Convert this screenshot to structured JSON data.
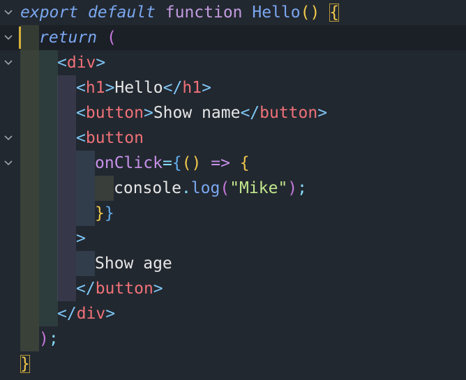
{
  "code_lines": [
    {
      "fold": "chevron-down",
      "tokens": [
        {
          "t": "export",
          "c": "kw"
        },
        {
          "t": " ",
          "c": "txt"
        },
        {
          "t": "default",
          "c": "kw"
        },
        {
          "t": " ",
          "c": "txt"
        },
        {
          "t": "function",
          "c": "fnkw"
        },
        {
          "t": " ",
          "c": "txt"
        },
        {
          "t": "Hello",
          "c": "fnname"
        },
        {
          "t": "()",
          "c": "paren-y"
        },
        {
          "t": " ",
          "c": "txt"
        },
        {
          "t": "{",
          "c": "paren-y bm"
        }
      ]
    },
    {
      "fold": "chevron-down",
      "current": true,
      "caret": true,
      "tokens": [
        {
          "t": "return",
          "c": "kw"
        },
        {
          "t": " ",
          "c": "txt"
        },
        {
          "t": "(",
          "c": "paren-p"
        }
      ]
    },
    {
      "fold": "chevron-down",
      "tokens": [
        {
          "t": "<",
          "c": "tagp"
        },
        {
          "t": "div",
          "c": "tag"
        },
        {
          "t": ">",
          "c": "tagp"
        }
      ]
    },
    {
      "tokens": [
        {
          "t": "<",
          "c": "tagp"
        },
        {
          "t": "h1",
          "c": "tag"
        },
        {
          "t": ">",
          "c": "tagp"
        },
        {
          "t": "Hello",
          "c": "txt"
        },
        {
          "t": "</",
          "c": "tagp"
        },
        {
          "t": "h1",
          "c": "tag"
        },
        {
          "t": ">",
          "c": "tagp"
        }
      ]
    },
    {
      "tokens": [
        {
          "t": "<",
          "c": "tagp"
        },
        {
          "t": "button",
          "c": "tag"
        },
        {
          "t": ">",
          "c": "tagp"
        },
        {
          "t": "Show name",
          "c": "txt"
        },
        {
          "t": "</",
          "c": "tagp"
        },
        {
          "t": "button",
          "c": "tag"
        },
        {
          "t": ">",
          "c": "tagp"
        }
      ]
    },
    {
      "fold": "chevron-down",
      "tokens": [
        {
          "t": "<",
          "c": "tagp"
        },
        {
          "t": "button",
          "c": "tag"
        }
      ]
    },
    {
      "fold": "chevron-down",
      "tokens": [
        {
          "t": "onClick",
          "c": "attr"
        },
        {
          "t": "=",
          "c": "op"
        },
        {
          "t": "{",
          "c": "paren-b"
        },
        {
          "t": "()",
          "c": "paren-y"
        },
        {
          "t": " ",
          "c": "txt"
        },
        {
          "t": "=>",
          "c": "attr"
        },
        {
          "t": " ",
          "c": "txt"
        },
        {
          "t": "{",
          "c": "paren-y"
        }
      ]
    },
    {
      "tokens": [
        {
          "t": "console",
          "c": "txt"
        },
        {
          "t": ".",
          "c": "op"
        },
        {
          "t": "log",
          "c": "method"
        },
        {
          "t": "(",
          "c": "paren-p"
        },
        {
          "t": "\"Mike\"",
          "c": "str"
        },
        {
          "t": ")",
          "c": "paren-p"
        },
        {
          "t": ";",
          "c": "op"
        }
      ]
    },
    {
      "tokens": [
        {
          "t": "}",
          "c": "paren-y"
        },
        {
          "t": "}",
          "c": "paren-b"
        }
      ]
    },
    {
      "tokens": [
        {
          "t": ">",
          "c": "tagp"
        }
      ]
    },
    {
      "tokens": [
        {
          "t": "Show age",
          "c": "txt"
        }
      ]
    },
    {
      "tokens": [
        {
          "t": "</",
          "c": "tagp"
        },
        {
          "t": "button",
          "c": "tag"
        },
        {
          "t": ">",
          "c": "tagp"
        }
      ]
    },
    {
      "tokens": [
        {
          "t": "</",
          "c": "tagp"
        },
        {
          "t": "div",
          "c": "tag"
        },
        {
          "t": ">",
          "c": "tagp"
        }
      ]
    },
    {
      "tokens": [
        {
          "t": ")",
          "c": "paren-p"
        },
        {
          "t": ";",
          "c": "op"
        }
      ]
    },
    {
      "tokens": [
        {
          "t": "}",
          "c": "paren-y bm"
        }
      ]
    }
  ]
}
